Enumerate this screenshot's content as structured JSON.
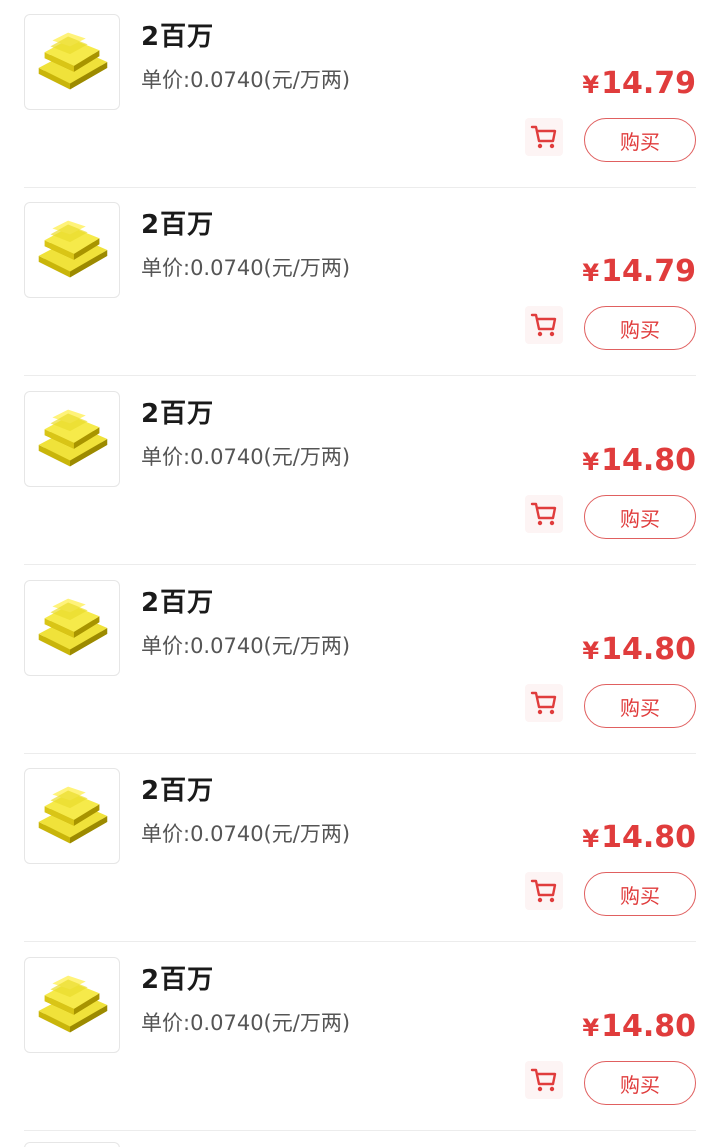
{
  "colors": {
    "price": "#e03c3c",
    "button_border": "#e06060",
    "gold": "#e6d21a"
  },
  "items": [
    {
      "name": "2百万",
      "unit_price": "单价:0.0740(元/万两)",
      "currency": "¥",
      "price": "14.79",
      "buy_label": "购买",
      "image_icon": "gold-bars-icon",
      "cart_icon": "cart-icon"
    },
    {
      "name": "2百万",
      "unit_price": "单价:0.0740(元/万两)",
      "currency": "¥",
      "price": "14.79",
      "buy_label": "购买",
      "image_icon": "gold-bars-icon",
      "cart_icon": "cart-icon"
    },
    {
      "name": "2百万",
      "unit_price": "单价:0.0740(元/万两)",
      "currency": "¥",
      "price": "14.80",
      "buy_label": "购买",
      "image_icon": "gold-bars-icon",
      "cart_icon": "cart-icon"
    },
    {
      "name": "2百万",
      "unit_price": "单价:0.0740(元/万两)",
      "currency": "¥",
      "price": "14.80",
      "buy_label": "购买",
      "image_icon": "gold-bars-icon",
      "cart_icon": "cart-icon"
    },
    {
      "name": "2百万",
      "unit_price": "单价:0.0740(元/万两)",
      "currency": "¥",
      "price": "14.80",
      "buy_label": "购买",
      "image_icon": "gold-bars-icon",
      "cart_icon": "cart-icon"
    },
    {
      "name": "2百万",
      "unit_price": "单价:0.0740(元/万两)",
      "currency": "¥",
      "price": "14.80",
      "buy_label": "购买",
      "image_icon": "gold-bars-icon",
      "cart_icon": "cart-icon"
    }
  ]
}
